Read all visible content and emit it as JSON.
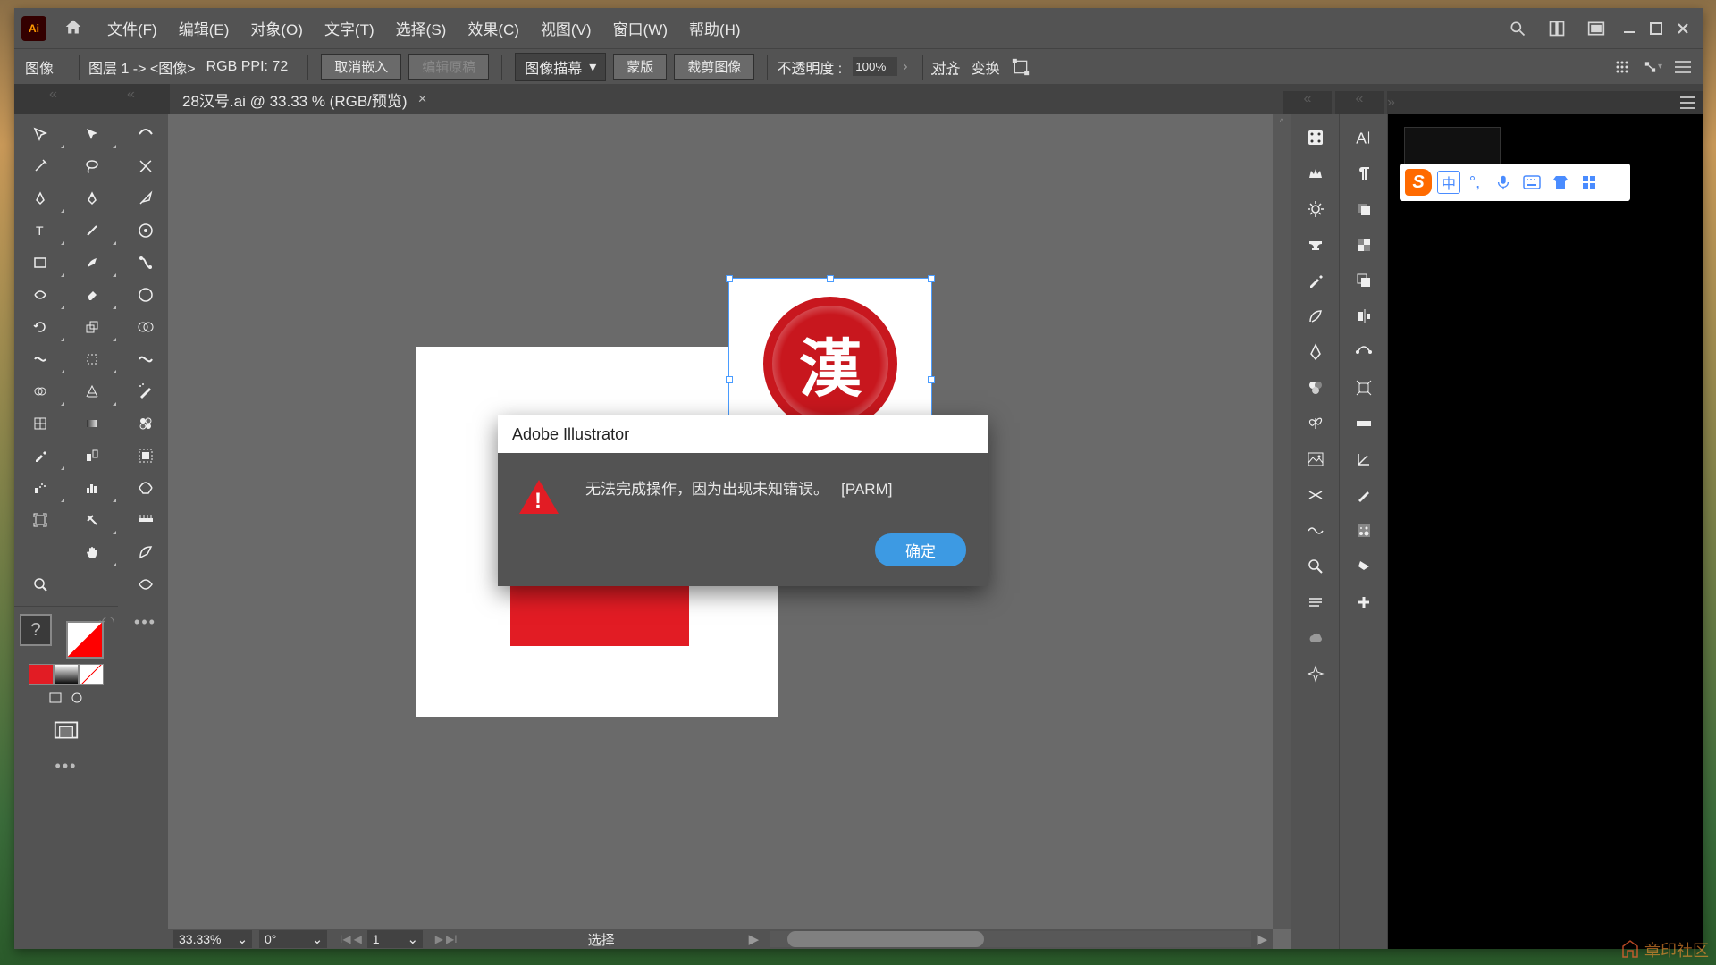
{
  "app": {
    "name": "Ai"
  },
  "menus": [
    "文件(F)",
    "编辑(E)",
    "对象(O)",
    "文字(T)",
    "选择(S)",
    "效果(C)",
    "视图(V)",
    "窗口(W)",
    "帮助(H)"
  ],
  "controlbar": {
    "type_label": "图像",
    "layer_info": "图层 1 -> <图像>",
    "color_mode": "RGB  PPI: 72",
    "unembed_btn": "取消嵌入",
    "edit_original_btn": "编辑原稿",
    "image_trace": "图像描幕",
    "mask_btn": "蒙版",
    "crop_btn": "裁剪图像",
    "opacity_label": "不透明度 :",
    "opacity_value": "100%",
    "align_btn": "对齐",
    "transform_btn": "变换"
  },
  "tab": {
    "title": "28汉号.ai @ 33.33 % (RGB/预览)"
  },
  "statusbar": {
    "zoom": "33.33%",
    "angle": "0°",
    "artboard_nav": "1",
    "mode": "选择"
  },
  "dialog": {
    "title": "Adobe Illustrator",
    "message": "无法完成操作，因为出现未知错误。",
    "code": "[PARM]",
    "ok": "确定"
  },
  "ime": {
    "lang": "中"
  },
  "watermark": "章印社区"
}
